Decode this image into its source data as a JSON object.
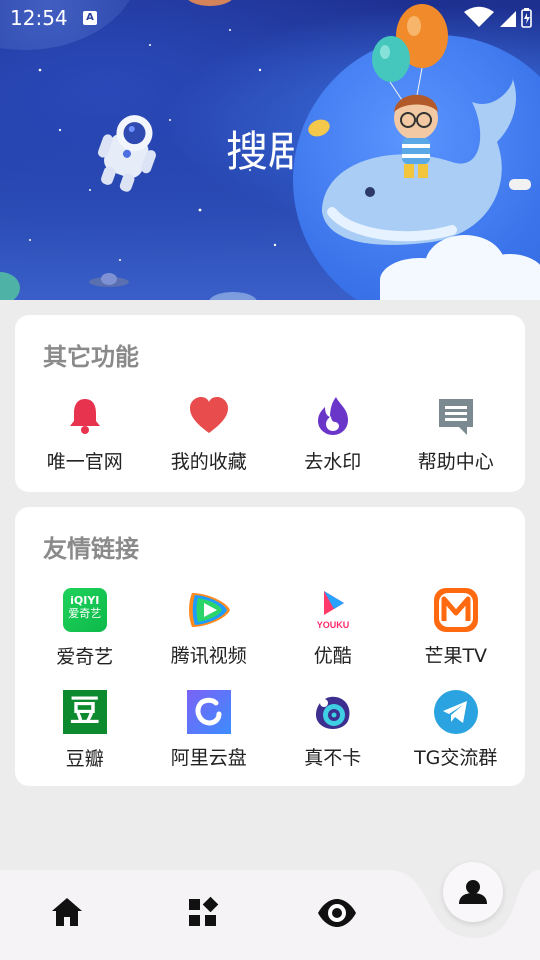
{
  "status_bar": {
    "time": "12:54",
    "badge": "A"
  },
  "banner": {
    "title": "搜剧"
  },
  "features": {
    "title": "其它功能",
    "items": [
      {
        "label": "唯一官网",
        "icon": "bell-icon",
        "color": "#e8334f"
      },
      {
        "label": "我的收藏",
        "icon": "heart-icon",
        "color": "#e84c4c"
      },
      {
        "label": "去水印",
        "icon": "flame-icon",
        "color": "#6a35c9"
      },
      {
        "label": "帮助中心",
        "icon": "chat-icon",
        "color": "#7b8a90"
      }
    ]
  },
  "links": {
    "title": "友情链接",
    "items": [
      {
        "label": "爱奇艺",
        "icon": "iqiyi-logo-icon",
        "logo_text": "iQIYI",
        "logo_sub": "爱奇艺"
      },
      {
        "label": "腾讯视频",
        "icon": "tencent-video-logo-icon"
      },
      {
        "label": "优酷",
        "icon": "youku-logo-icon",
        "logo_text": "YOUKU"
      },
      {
        "label": "芒果TV",
        "icon": "mango-tv-logo-icon"
      },
      {
        "label": "豆瓣",
        "icon": "douban-logo-icon",
        "logo_text": "豆"
      },
      {
        "label": "阿里云盘",
        "icon": "aliyun-drive-logo-icon"
      },
      {
        "label": "真不卡",
        "icon": "zhenbuka-logo-icon"
      },
      {
        "label": "TG交流群",
        "icon": "telegram-logo-icon"
      }
    ]
  },
  "bottom_nav": {
    "items": [
      {
        "icon": "home-icon"
      },
      {
        "icon": "apps-icon"
      },
      {
        "icon": "eye-icon"
      },
      {
        "icon": "profile-icon",
        "active": true
      }
    ]
  }
}
